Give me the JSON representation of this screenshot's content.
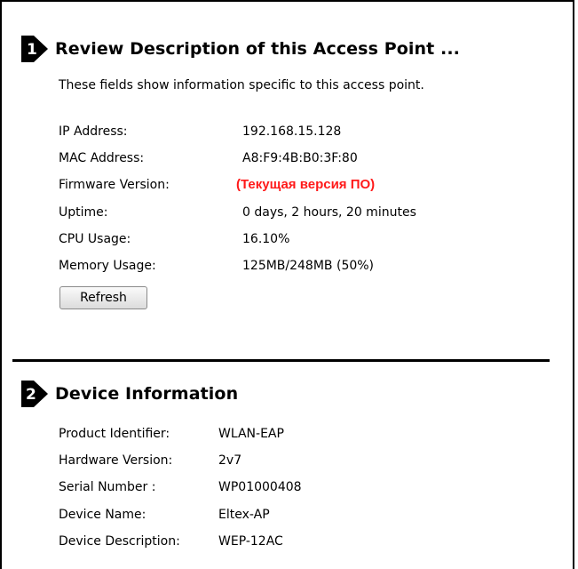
{
  "section1": {
    "number": "1",
    "title": "Review Description of this Access Point ...",
    "description": "These fields show information specific to this access point.",
    "fields": [
      {
        "label": "IP Address:",
        "value": "192.168.15.128"
      },
      {
        "label": "MAC Address:",
        "value": "A8:F9:4B:B0:3F:80"
      },
      {
        "label": "Firmware Version:",
        "value": "(Текущая версия ПО)"
      },
      {
        "label": "Uptime:",
        "value": "0 days, 2 hours, 20 minutes"
      },
      {
        "label": "CPU Usage:",
        "value": "16.10%"
      },
      {
        "label": "Memory Usage:",
        "value": "125MB/248MB (50%)"
      }
    ],
    "refresh_label": "Refresh"
  },
  "section2": {
    "number": "2",
    "title": "Device Information",
    "fields": [
      {
        "label": "Product Identifier:",
        "value": "WLAN-EAP"
      },
      {
        "label": "Hardware Version:",
        "value": "2v7"
      },
      {
        "label": "Serial Number :",
        "value": "WP01000408"
      },
      {
        "label": "Device Name:",
        "value": "Eltex-AP"
      },
      {
        "label": "Device Description:",
        "value": "WEP-12AC"
      }
    ]
  },
  "colors": {
    "firmware_value": "#ff1a1a",
    "border": "#000000"
  },
  "icons": {
    "section_badge": "step-arrow-icon"
  }
}
